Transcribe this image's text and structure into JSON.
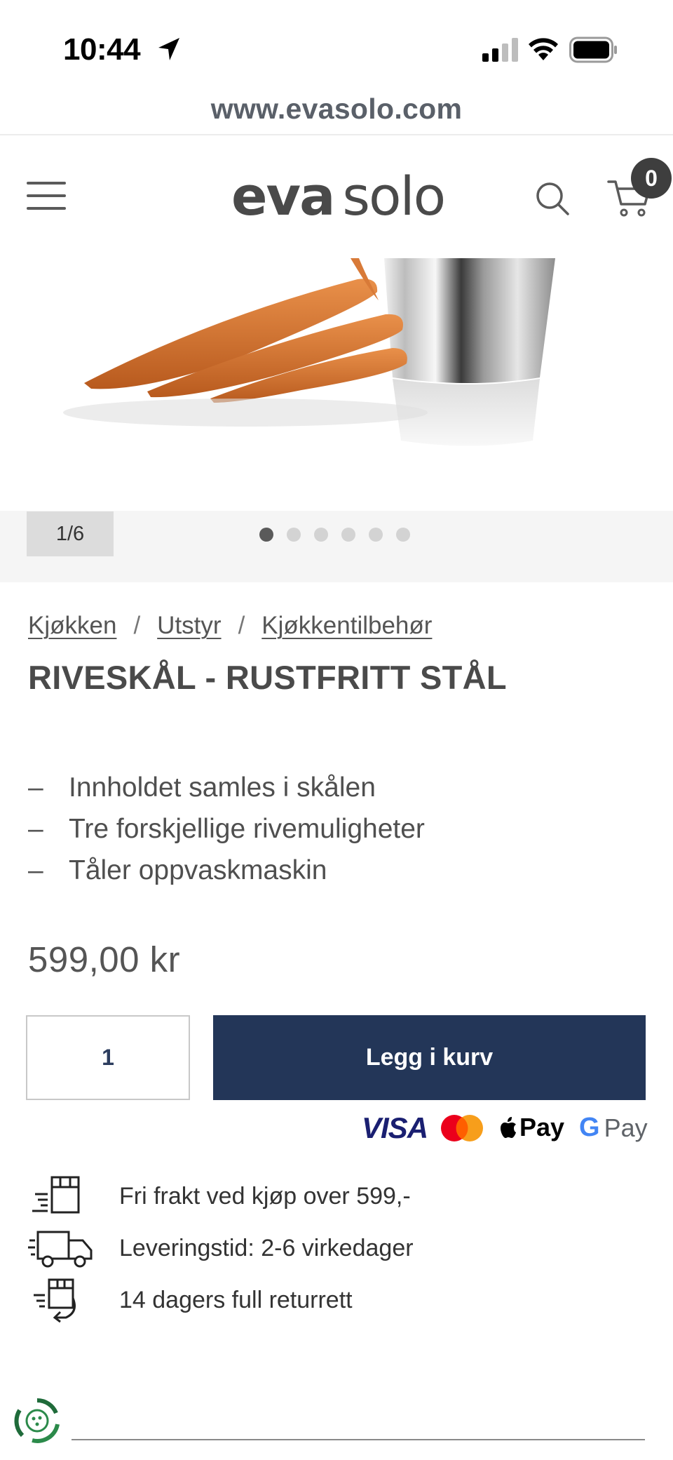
{
  "status_bar": {
    "time": "10:44"
  },
  "browser": {
    "url": "www.evasolo.com"
  },
  "header": {
    "logo_part_1": "eva",
    "logo_part_2": "solo",
    "cart_count": "0",
    "menu_icon": "hamburger-icon",
    "search_icon": "search-icon",
    "cart_icon": "cart-icon"
  },
  "gallery": {
    "counter": "1/6",
    "total_slides": 6,
    "active_slide": 1
  },
  "breadcrumb": [
    {
      "label": "Kjøkken"
    },
    {
      "label": "Utstyr"
    },
    {
      "label": "Kjøkkentilbehør"
    }
  ],
  "breadcrumb_separator": "/",
  "product": {
    "title": "RIVESKÅL - RUSTFRITT STÅL",
    "features": [
      "Innholdet samles i skålen",
      "Tre forskjellige rivemuligheter",
      "Tåler oppvaskmaskin"
    ],
    "feature_bullet": "–",
    "price": "599,00 kr",
    "quantity": "1",
    "add_to_cart_label": "Legg i kurv"
  },
  "payment_methods": {
    "visa": "VISA",
    "apple_pay": "Pay",
    "google_pay_g": "G",
    "google_pay": "Pay"
  },
  "usps": [
    {
      "icon": "box-delivery-icon",
      "text": "Fri frakt ved kjøp over 599,-"
    },
    {
      "icon": "truck-icon",
      "text": "Leveringstid: 2-6 virkedager"
    },
    {
      "icon": "return-box-icon",
      "text": "14 dagers full returrett"
    }
  ],
  "colors": {
    "primary_button": "#233658",
    "badge": "#3e3e3e",
    "text": "#4a4a4a",
    "hero_background": "#f5f5f5"
  }
}
